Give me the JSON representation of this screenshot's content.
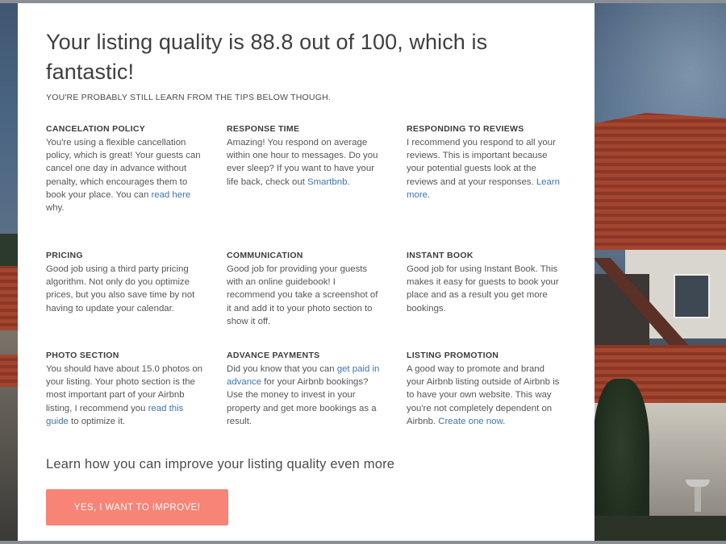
{
  "header": {
    "headline": "Your listing quality is 88.8 out of 100, which is fantastic!",
    "subhead": "YOU'RE PROBABLY STILL LEARN FROM THE TIPS BELOW THOUGH."
  },
  "tips": [
    {
      "title": "CANCELATION POLICY",
      "body": "You're using a flexible cancellation policy, which is great! Your guests can cancel one day in advance without penalty, which encourages them to book your place. You can ",
      "link": "read here",
      "after": " why."
    },
    {
      "title": "RESPONSE TIME",
      "body": "Amazing! You respond on average within one hour to messages. Do you ever sleep? If you want to have your life back, check out ",
      "link": "Smartbnb",
      "after": "."
    },
    {
      "title": "RESPONDING TO REVIEWS",
      "body": "I recommend you respond to all your reviews. This is important because your potential guests look at the reviews and at your responses. ",
      "link": "Learn more",
      "after": "."
    },
    {
      "title": "PRICING",
      "body": "Good job using a third party pricing algorithm. Not only do you optimize prices, but you also save time by not having to update your calendar.",
      "link": "",
      "after": ""
    },
    {
      "title": "COMMUNICATION",
      "body": "Good job for providing your guests with an online guidebook! I recommend you take a screenshot of it and add it to your photo section to show it off.",
      "link": "",
      "after": ""
    },
    {
      "title": "INSTANT BOOK",
      "body": "Good job for using Instant Book. This makes it easy for guests to book your place and as a result you get more bookings.",
      "link": "",
      "after": ""
    },
    {
      "title": "PHOTO SECTION",
      "body": "You should have about 15.0 photos on your listing. Your photo section is the most important part of your Airbnb listing, I recommend you ",
      "link": "read this guide",
      "after": " to optimize it."
    },
    {
      "title": "ADVANCE PAYMENTS",
      "body": "Did you know that you can ",
      "link": "get paid in advance",
      "after": " for your Airbnb bookings? Use the money to invest in your property and get more bookings as a result."
    },
    {
      "title": "LISTING PROMOTION",
      "body": "A good way to promote and brand your Airbnb listing outside of Airbnb is to have your own website. This way you're not completely dependent on Airbnb. ",
      "link": "Create one now",
      "after": "."
    }
  ],
  "footer": {
    "learn_more": "Learn how you can improve your listing quality even more",
    "cta_label": "YES, I WANT TO IMPROVE!"
  },
  "colors": {
    "cta": "#f78476",
    "link": "#3e74b0",
    "text": "#484848"
  }
}
